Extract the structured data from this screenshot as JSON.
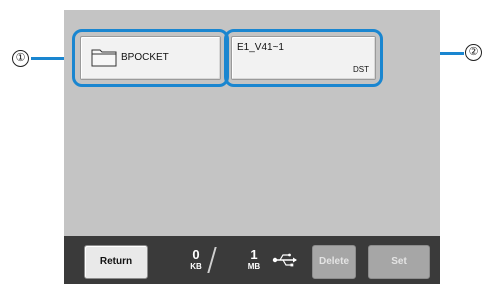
{
  "callouts": [
    "①",
    "②"
  ],
  "folder": {
    "label": "BPOCKET",
    "icon": "folder-icon"
  },
  "file": {
    "name": "E1_V41~1",
    "ext": "DST"
  },
  "bottom_bar": {
    "return_label": "Return",
    "memory_used_value": "0",
    "memory_used_unit": "KB",
    "memory_total_value": "1",
    "memory_total_unit": "MB",
    "usb_icon": "usb-icon",
    "delete_label": "Delete",
    "set_label": "Set"
  },
  "colors": {
    "highlight": "#1a86d0",
    "screen_bg": "#c4c4c4",
    "bar_bg": "#3a3a3a"
  }
}
